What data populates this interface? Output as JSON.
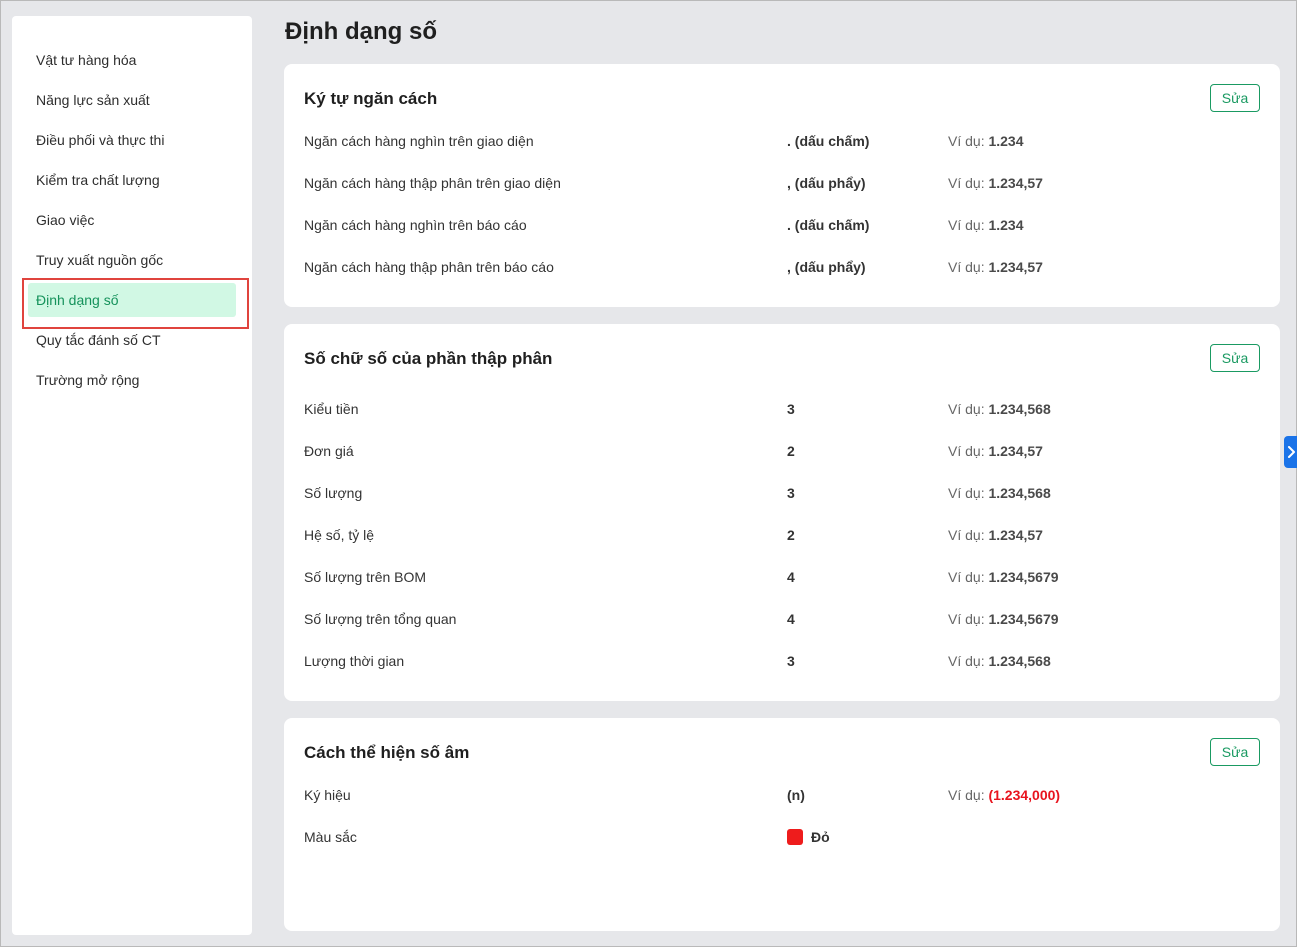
{
  "sidebar": {
    "items": [
      {
        "label": "Vật tư hàng hóa"
      },
      {
        "label": "Năng lực sản xuất"
      },
      {
        "label": "Điều phối và thực thi"
      },
      {
        "label": "Kiểm tra chất lượng"
      },
      {
        "label": "Giao việc"
      },
      {
        "label": "Truy xuất nguồn gốc"
      },
      {
        "label": "Định dạng số",
        "active": true
      },
      {
        "label": "Quy tắc đánh số CT"
      },
      {
        "label": "Trường mở rộng"
      }
    ]
  },
  "page_title": "Định dạng số",
  "example_prefix": "Ví dụ: ",
  "sections": [
    {
      "title": "Ký tự ngăn cách",
      "edit_label": "Sửa",
      "rows": [
        {
          "label": "Ngăn cách hàng nghìn trên giao diện",
          "value": ". (dấu chấm)",
          "example": "1.234"
        },
        {
          "label": "Ngăn cách hàng thập phân trên giao diện",
          "value": ", (dấu phẩy)",
          "example": "1.234,57"
        },
        {
          "label": "Ngăn cách hàng nghìn trên báo cáo",
          "value": ". (dấu chấm)",
          "example": "1.234"
        },
        {
          "label": "Ngăn cách hàng thập phân trên báo cáo",
          "value": ", (dấu phẩy)",
          "example": "1.234,57"
        }
      ]
    },
    {
      "title": "Số chữ số của phần thập phân",
      "edit_label": "Sửa",
      "rows": [
        {
          "label": "Kiểu tiền",
          "value": "3",
          "example": "1.234,568"
        },
        {
          "label": "Đơn giá",
          "value": "2",
          "example": "1.234,57"
        },
        {
          "label": "Số lượng",
          "value": "3",
          "example": "1.234,568"
        },
        {
          "label": "Hệ số, tỷ lệ",
          "value": "2",
          "example": "1.234,57"
        },
        {
          "label": "Số lượng trên BOM",
          "value": "4",
          "example": "1.234,5679"
        },
        {
          "label": "Số lượng trên tổng quan",
          "value": "4",
          "example": "1.234,5679"
        },
        {
          "label": "Lượng thời gian",
          "value": "3",
          "example": "1.234,568"
        }
      ]
    },
    {
      "title": "Cách thể hiện số âm",
      "edit_label": "Sửa",
      "rows": [
        {
          "label": "Ký hiệu",
          "value": "(n)",
          "example": "(1.234,000)",
          "example_color": "#e8141e"
        },
        {
          "label": "Màu sắc",
          "value": "Đỏ",
          "swatch_color": "#ee1c1c"
        }
      ]
    }
  ],
  "colors": {
    "accent": "#1a9a62",
    "active_bg": "#d1f8e4",
    "negative": "#e8141e",
    "highlight_border": "#e0443e",
    "toggle": "#1a73e8"
  },
  "icons": {
    "side_toggle": "chevron-right-icon"
  }
}
